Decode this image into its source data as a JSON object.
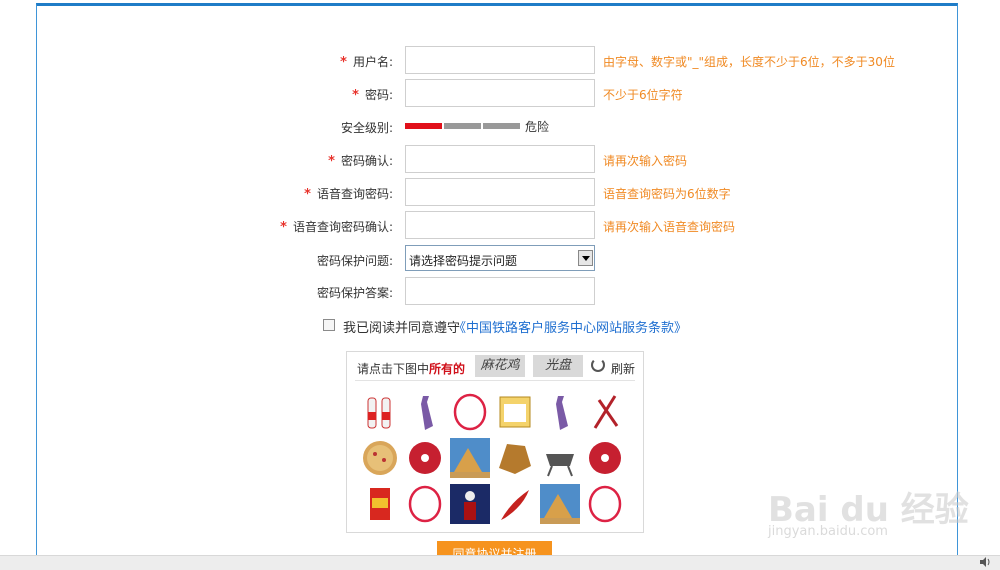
{
  "form": {
    "username": {
      "label": "用户名:",
      "hint": "由字母、数字或\"_\"组成，长度不少于6位，不多于30位",
      "value": ""
    },
    "password": {
      "label": "密码:",
      "hint": "不少于6位字符",
      "value": ""
    },
    "strength": {
      "label": "安全级别:",
      "level_text": "危险",
      "level": 1,
      "segments": 3,
      "active_color": "#e1101a"
    },
    "confirm": {
      "label": "密码确认:",
      "hint": "请再次输入密码",
      "value": ""
    },
    "voice_password": {
      "label": "语音查询密码:",
      "hint": "语音查询密码为6位数字",
      "value": ""
    },
    "voice_confirm": {
      "label": "语音查询密码确认:",
      "hint": "请再次输入语音查询密码",
      "value": ""
    },
    "security_question": {
      "label": "密码保护问题:",
      "selected": "请选择密码提示问题"
    },
    "security_answer": {
      "label": "密码保护答案:",
      "value": ""
    },
    "required_mark": "*"
  },
  "agreement": {
    "text": "我已阅读并同意遵守",
    "link": "《中国铁路客户服务中心网站服务条款》",
    "checked": false
  },
  "captcha": {
    "prompt_prefix": "请点击下图中",
    "prompt_emphasis": "所有的",
    "word1": "麻花鸡",
    "word2": "光盘",
    "refresh_label": "刷新",
    "tiles": [
      "bottles-icon",
      "necktie-icon",
      "hula-hoop-icon",
      "calendar-icon",
      "necktie-icon",
      "chopsticks-icon",
      "pizza-icon",
      "cd-icon",
      "pyramid-icon",
      "stone-icon",
      "grill-icon",
      "cd-icon",
      "snack-bag-icon",
      "hula-hoop-icon",
      "person-icon",
      "feather-icon",
      "pyramid-icon",
      "hula-hoop-icon"
    ]
  },
  "submit_label": "同意协议并注册",
  "watermark": {
    "logo": "Bai du 经验",
    "url": "jingyan.baidu.com"
  },
  "colors": {
    "accent": "#1f7cc7",
    "hint": "#f08a24",
    "required": "#e8322b",
    "link": "#1f6fd0",
    "button": "#f6931e"
  }
}
